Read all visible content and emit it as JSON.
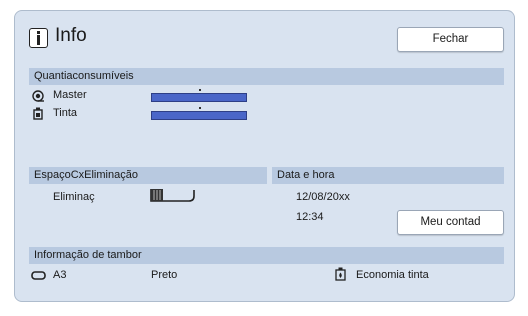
{
  "window": {
    "title": "Info",
    "close_label": "Fechar"
  },
  "consumables": {
    "header": "Quantiaconsumíveis",
    "master_label": "Master",
    "ink_label": "Tinta",
    "master_level": 1.0,
    "ink_level": 1.0
  },
  "disposal": {
    "header": "EspaçoCxEliminação",
    "label": "Eliminaç"
  },
  "datetime": {
    "header": "Data e hora",
    "date": "12/08/20xx",
    "time": "12:34",
    "counter_label": "Meu contad"
  },
  "drum": {
    "header": "Informação de tambor",
    "size": "A3",
    "color": "Preto",
    "mode": "Economia tinta"
  },
  "colors": {
    "panel": "#d9e3f0",
    "section_header": "#b8c9e0",
    "bar": "#4a66c8"
  },
  "icons": [
    "info-icon",
    "master-roll-icon",
    "ink-bottle-icon",
    "disposal-box-icon",
    "drum-icon",
    "ink-saving-icon"
  ]
}
